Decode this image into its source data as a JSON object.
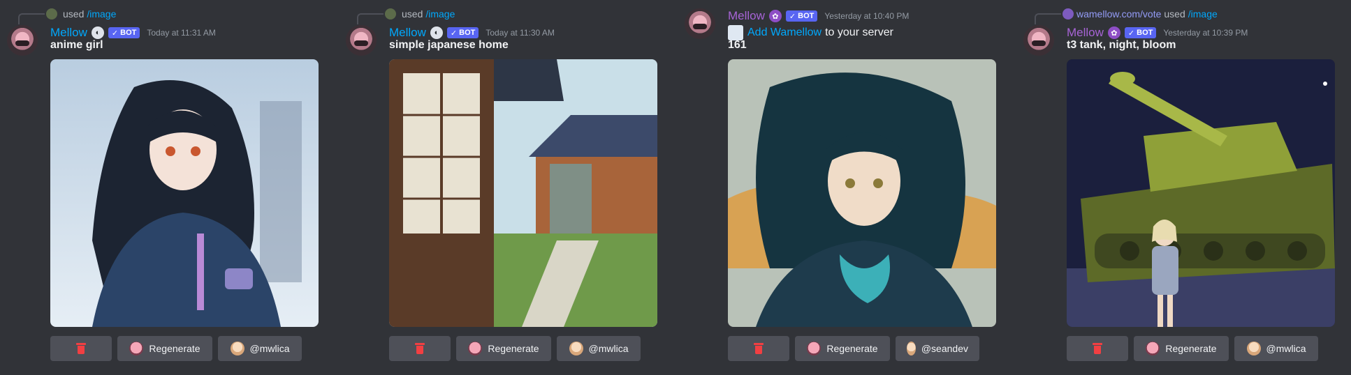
{
  "messages": [
    {
      "reply": {
        "name": "",
        "used": "used",
        "command": "/image"
      },
      "author": "Mellow",
      "author_color": "#00a8fc",
      "bot_tag": "BOT",
      "timestamp": "Today at 11:31 AM",
      "prompt": "anime girl",
      "buttons": {
        "regenerate": "Regenerate",
        "user": "@mwlica"
      }
    },
    {
      "reply": {
        "name": "",
        "used": "used",
        "command": "/image"
      },
      "author": "Mellow",
      "author_color": "#00a8fc",
      "bot_tag": "BOT",
      "timestamp": "Today at 11:30 AM",
      "prompt": "simple japanese home",
      "buttons": {
        "regenerate": "Regenerate",
        "user": "@mwlica"
      }
    },
    {
      "author": "Mellow",
      "author_color": "#a764d6",
      "bot_tag": "BOT",
      "timestamp": "Yesterday at 10:40 PM",
      "add_link": "Add Wamellow",
      "add_suffix": "to your server",
      "prompt": "161",
      "buttons": {
        "regenerate": "Regenerate",
        "user": "@seandev"
      }
    },
    {
      "reply": {
        "name": "wamellow.com/vote",
        "used": "used",
        "command": "/image"
      },
      "author": "Mellow",
      "author_color": "#a764d6",
      "bot_tag": "BOT",
      "timestamp": "Yesterday at 10:39 PM",
      "prompt": "t3 tank, night, bloom",
      "buttons": {
        "regenerate": "Regenerate",
        "user": "@mwlica"
      }
    }
  ],
  "colors": {
    "background": "#313338",
    "button": "#4e5058",
    "danger": "#f23f42",
    "link": "#00a8fc",
    "bot_badge": "#5865f2"
  },
  "icons": {
    "delete": "trash-icon",
    "verified": "check-icon"
  }
}
